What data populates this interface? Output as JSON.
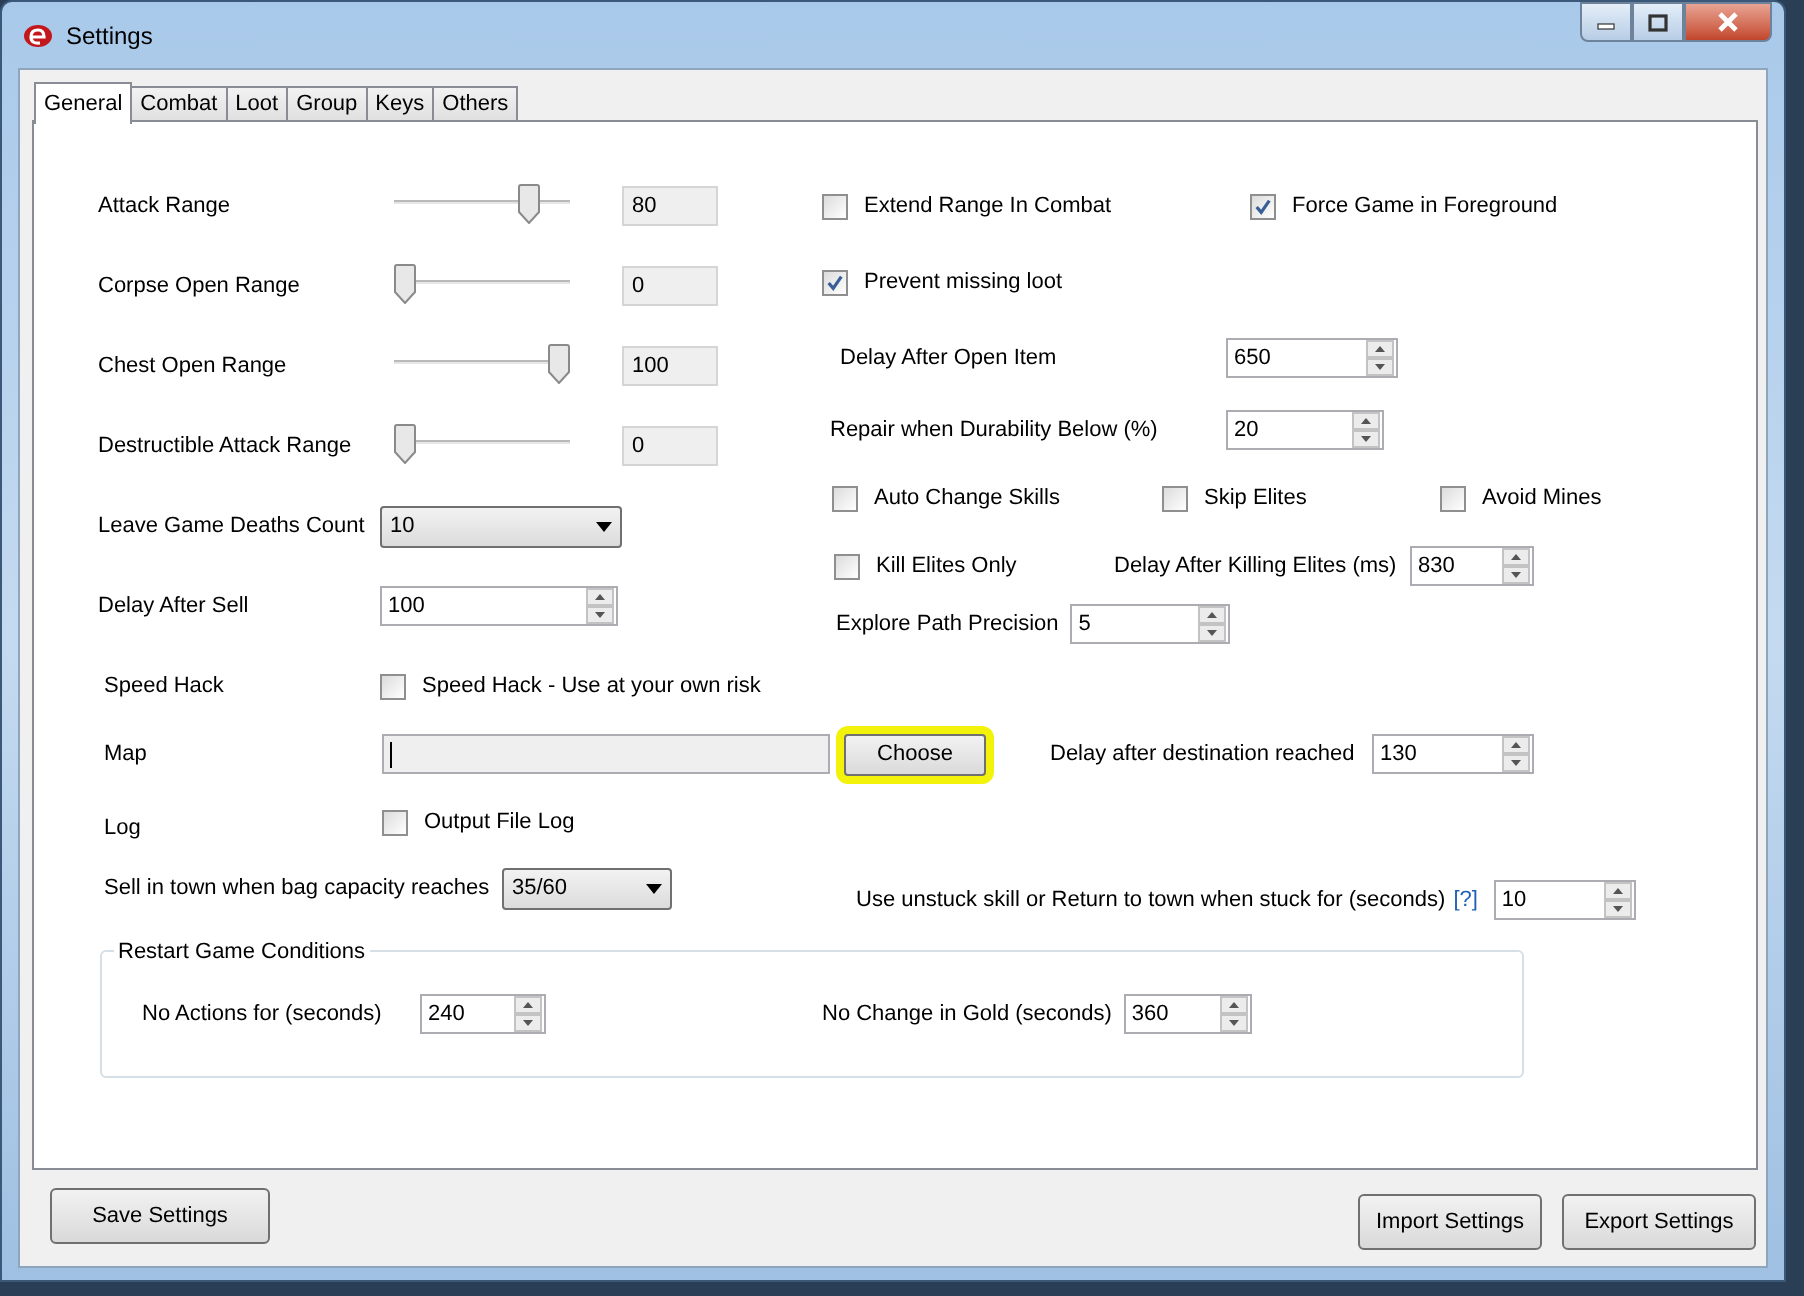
{
  "window": {
    "title": "Settings"
  },
  "tabs": [
    {
      "label": "General",
      "selected": true
    },
    {
      "label": "Combat",
      "selected": false
    },
    {
      "label": "Loot",
      "selected": false
    },
    {
      "label": "Group",
      "selected": false
    },
    {
      "label": "Keys",
      "selected": false
    },
    {
      "label": "Others",
      "selected": false
    }
  ],
  "left_rows": [
    {
      "kind": "slider",
      "label": "Attack Range",
      "level": 0.8,
      "value": "80"
    },
    {
      "kind": "slider",
      "label": "Corpse Open Range",
      "level": 0,
      "value": "0"
    },
    {
      "kind": "slider",
      "label": "Chest Open Range",
      "level": 1,
      "value": "100"
    },
    {
      "kind": "slider",
      "label": "Destructible Attack Range",
      "level": 0,
      "value": "0"
    },
    {
      "kind": "dropdown",
      "label": "Leave Game Deaths Count",
      "value": "10"
    },
    {
      "kind": "spin",
      "label": "Delay After Sell",
      "value": "100"
    },
    {
      "kind": "checkbox",
      "label": "Speed Hack",
      "text": "Speed Hack - Use at your own risk",
      "checked": false
    }
  ],
  "right_rows": [
    {
      "items": [
        {
          "kind": "checkbox",
          "text": "Extend Range In Combat",
          "checked": false
        },
        {
          "kind": "checkbox",
          "text": "Force Game in Foreground",
          "checked": true
        }
      ]
    },
    {
      "items": [
        {
          "kind": "checkbox",
          "text": "Prevent missing loot",
          "checked": true
        }
      ]
    },
    {
      "items": [
        {
          "kind": "spin",
          "label": "Delay After Open Item",
          "value": "650"
        }
      ]
    },
    {
      "items": [
        {
          "kind": "spin",
          "label": "Repair when Durability Below (%)",
          "value": "20"
        }
      ]
    },
    {
      "items": [
        {
          "kind": "checkbox",
          "text": "Auto Change Skills",
          "checked": false
        },
        {
          "kind": "checkbox",
          "text": "Skip Elites",
          "checked": false
        },
        {
          "kind": "checkbox",
          "text": "Avoid Mines",
          "checked": false
        }
      ]
    },
    {
      "items": [
        {
          "kind": "checkbox",
          "text": "Kill Elites Only",
          "checked": false
        },
        {
          "kind": "spin",
          "label": "Delay After Killing Elites (ms)",
          "value": "830"
        }
      ]
    },
    {
      "items": [
        {
          "kind": "spin",
          "label": "Explore Path Precision",
          "value": "5"
        }
      ]
    }
  ],
  "map": {
    "label": "Map",
    "button": "Choose",
    "button_highlighted": true,
    "delay_label": "Delay after destination reached",
    "delay_value": "130"
  },
  "log": {
    "label": "Log",
    "text": "Output File Log",
    "checked": false
  },
  "sell": {
    "label": "Sell in town when bag capacity reaches",
    "value": "35/60"
  },
  "unstuck": {
    "label": "Use unstuck skill or Return to town when stuck for (seconds)",
    "help": "[?]",
    "value": "10"
  },
  "restart_group": {
    "title": "Restart Game Conditions",
    "fields": [
      {
        "label": "No Actions for (seconds)",
        "value": "240"
      },
      {
        "label": "No Change in Gold (seconds)",
        "value": "360"
      }
    ]
  },
  "buttons": {
    "save": "Save Settings",
    "import": "Import Settings",
    "export": "Export Settings"
  }
}
